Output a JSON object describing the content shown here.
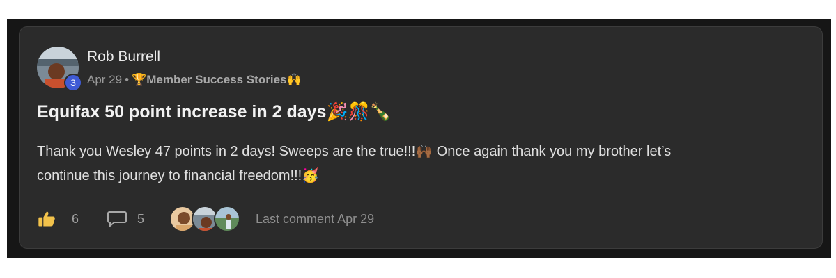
{
  "post": {
    "author": "Rob Burrell",
    "level": "3",
    "date": "Apr 29",
    "separator": "•",
    "category_prefix_emoji": "🏆",
    "category": "Member Success Stories",
    "category_suffix_emoji": "🙌",
    "title": "Equifax 50 point increase in 2 days",
    "title_emojis": "🎉🎊🍾",
    "body_line1": "Thank you Wesley 47 points in 2 days! Sweeps are the true!!!🙌🏾 Once again thank you my brother let’s",
    "body_line2": "continue this journey to financial freedom!!!🥳"
  },
  "footer": {
    "likes": "6",
    "comments": "5",
    "last_comment": "Last comment Apr 29"
  },
  "icons": [
    "thumbs-up-icon",
    "comment-icon"
  ],
  "colors": {
    "card_bg": "#2b2b2b",
    "frame_bg": "#161616",
    "badge": "#3f5bd5",
    "like": "#f2c24b"
  }
}
